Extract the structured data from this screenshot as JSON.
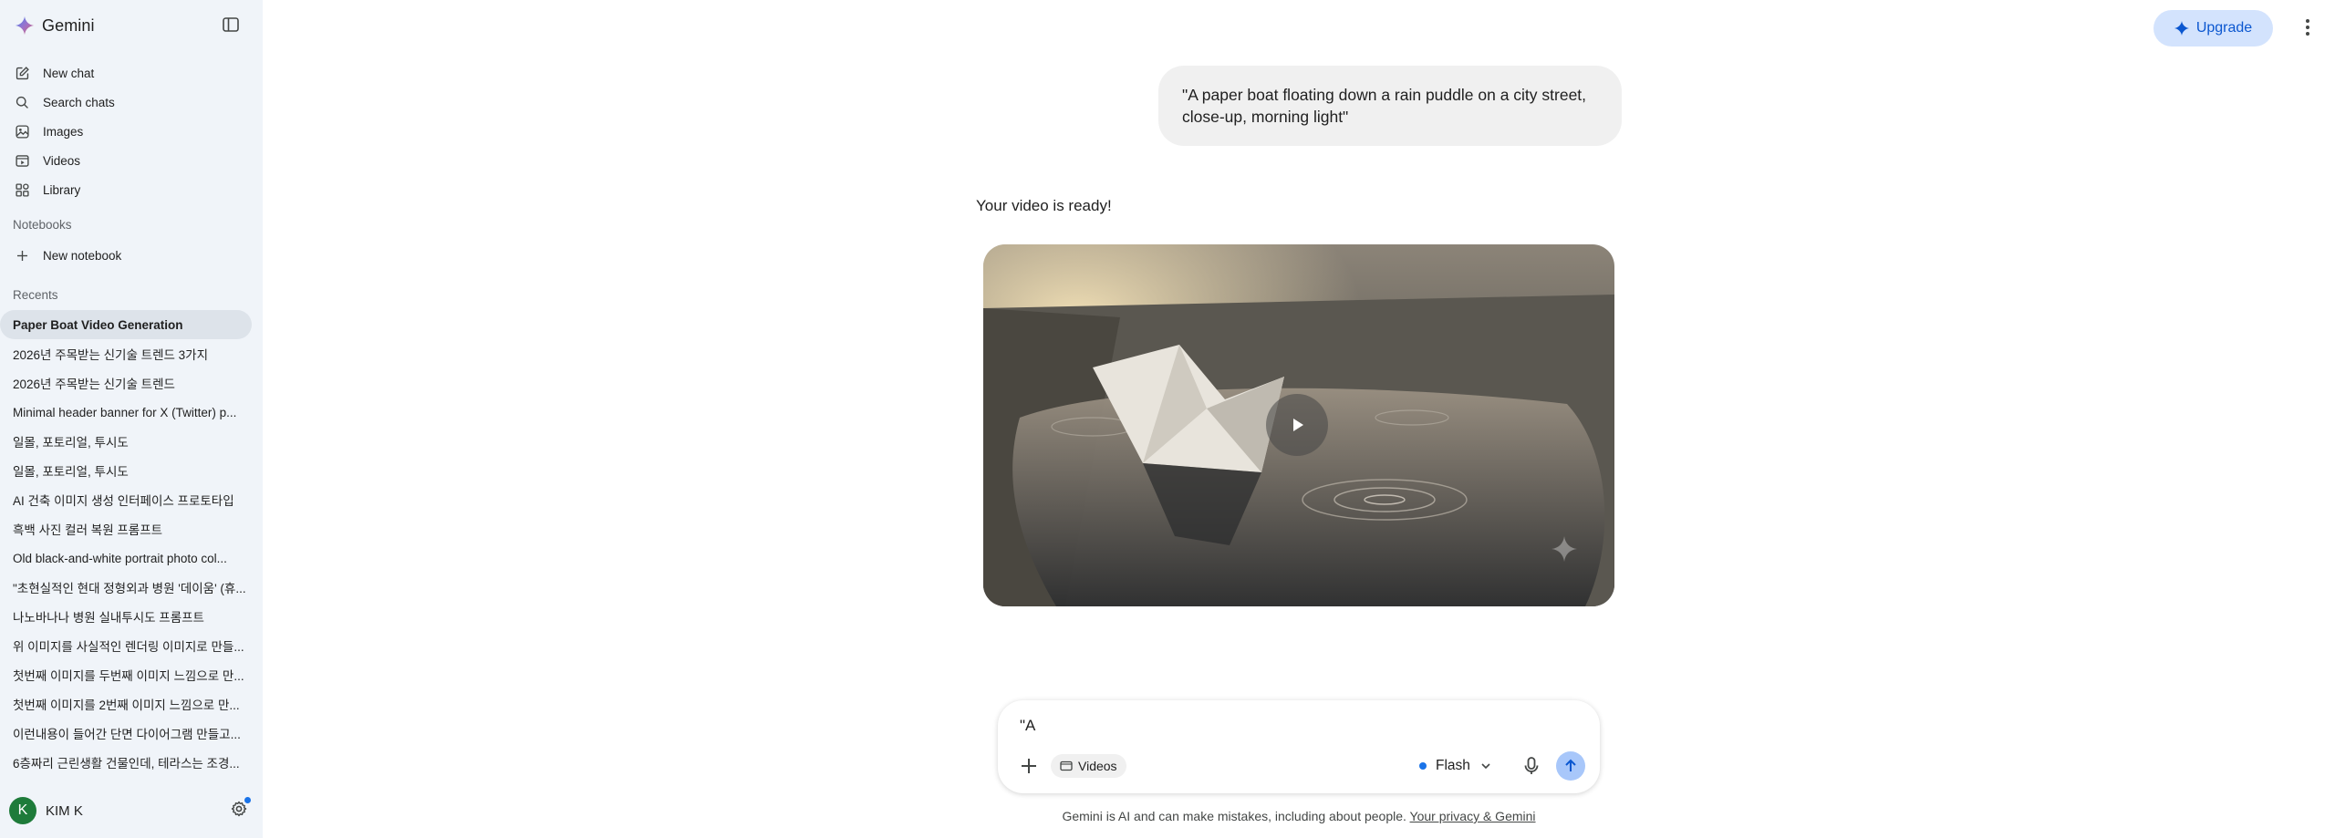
{
  "app": {
    "name": "Gemini"
  },
  "sidebar": {
    "nav": [
      {
        "label": "New chat",
        "icon": "new-chat-icon"
      },
      {
        "label": "Search chats",
        "icon": "search-icon"
      },
      {
        "label": "Images",
        "icon": "images-icon"
      },
      {
        "label": "Videos",
        "icon": "videos-icon"
      },
      {
        "label": "Library",
        "icon": "library-icon"
      }
    ],
    "notebooks_label": "Notebooks",
    "new_notebook": "New notebook",
    "recents_label": "Recents",
    "recents": [
      "Paper Boat Video Generation",
      "2026년 주목받는 신기술 트렌드 3가지",
      "2026년 주목받는 신기술 트렌드",
      "Minimal header banner for X (Twitter) p...",
      "일몰, 포토리얼, 투시도",
      "일몰, 포토리얼, 투시도",
      "AI 건축 이미지 생성 인터페이스 프로토타입",
      "흑백 사진 컬러 복원 프롬프트",
      "Old black-and-white portrait photo col...",
      "\"초현실적인 현대 정형외과 병원 '데이움' (휴...",
      "나노바나나 병원 실내투시도 프롬프트",
      "위 이미지를 사실적인 렌더링 이미지로 만들...",
      "첫번째 이미지를 두번째 이미지 느낌으로 만...",
      "첫번째 이미지를 2번째 이미지 느낌으로 만...",
      "이런내용이 들어간 단면 다이어그램 만들고...",
      "6층짜리 근린생활 건물인데, 테라스는 조경..."
    ],
    "user": {
      "initial": "K",
      "name": "KIM K"
    }
  },
  "header": {
    "upgrade_label": "Upgrade"
  },
  "chat": {
    "user_prompt": "\"A paper boat floating down a rain puddle on a city street, close-up, morning light\"",
    "response_text": "Your video is ready!"
  },
  "composer": {
    "input_value": "\"A",
    "tool_chip": "Videos",
    "model": "Flash"
  },
  "footer": {
    "disclaimer": "Gemini is AI and can make mistakes, including about people.",
    "privacy_link": "Your privacy & Gemini"
  },
  "colors": {
    "sidebar_bg": "#f0f4f9",
    "accent": "#0b57d0",
    "upgrade_bg": "#d3e3fd",
    "send_bg": "#a8c7fa",
    "active_recent_bg": "#dde3ea",
    "avatar_bg": "#1e7b3a"
  }
}
